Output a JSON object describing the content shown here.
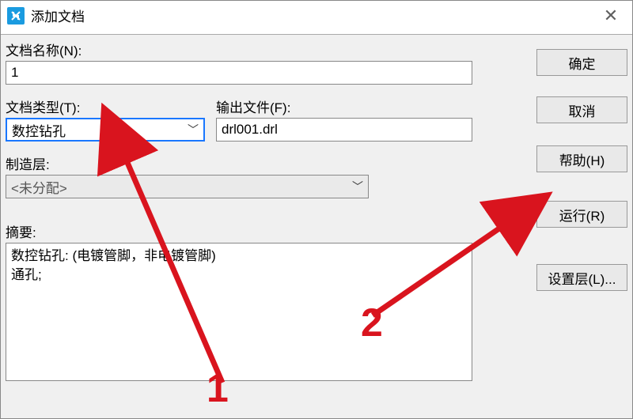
{
  "window": {
    "title": "添加文档",
    "close_glyph": "✕"
  },
  "labels": {
    "doc_name": "文档名称(N):",
    "doc_type": "文档类型(T):",
    "output_file": "输出文件(F):",
    "mfg_layer": "制造层:",
    "summary": "摘要:"
  },
  "fields": {
    "doc_name_value": "1",
    "doc_type_value": "数控钻孔",
    "output_file_value": "drl001.drl",
    "mfg_layer_value": "<未分配>",
    "summary_value": "数控钻孔: (电镀管脚，非电镀管脚)\n通孔;"
  },
  "buttons": {
    "ok": "确定",
    "cancel": "取消",
    "help": "帮助(H)",
    "run": "运行(R)",
    "set_layer": "设置层(L)..."
  },
  "annotations": {
    "mark1": "1",
    "mark2": "2"
  }
}
